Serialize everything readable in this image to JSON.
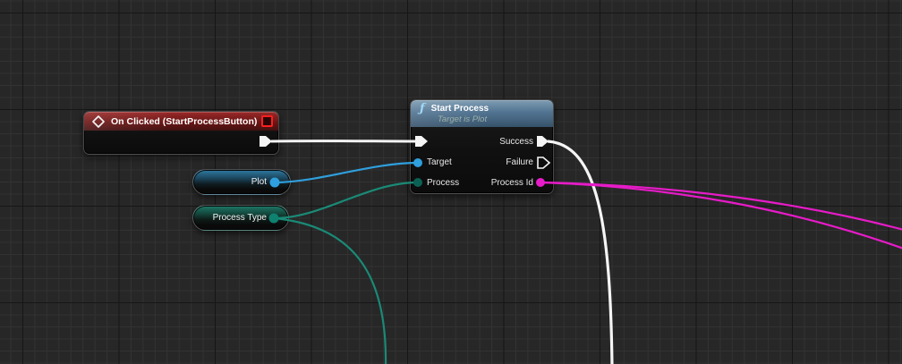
{
  "app": "blueprint-graph",
  "colors": {
    "background": "#272727",
    "grid_minor": "#323232",
    "grid_major": "#161616",
    "wire_exec": "#f5f5f5",
    "wire_object": "#2f9fdd",
    "wire_process": "#1a8a76",
    "wire_id": "#e71bc8",
    "pin_exec": "#f5f5f5",
    "pin_object": "#2f9fdd",
    "pin_process": "#0e8170",
    "pin_process_dark": "#0b6154",
    "pin_id": "#e71bc8",
    "event_header_red": "#8a2222",
    "function_header_blue": "#55809c",
    "delegate_red": "#ff1e1e"
  },
  "nodes": {
    "on_clicked": {
      "title": "On Clicked (StartProcessButton)",
      "icon": "event-diamond-icon",
      "delegate_pin": "red-square-delegate-pin",
      "exec_out": ""
    },
    "start_process": {
      "title": "Start Process",
      "subtitle": "Target is Plot",
      "function_icon": "ƒ",
      "inputs": [
        {
          "label": "Target",
          "type": "object"
        },
        {
          "label": "Process",
          "type": "process"
        }
      ],
      "outputs": [
        {
          "label": "Success",
          "type": "exec"
        },
        {
          "label": "Failure",
          "type": "exec"
        },
        {
          "label": "Process Id",
          "type": "id"
        }
      ]
    },
    "plot": {
      "label": "Plot",
      "type": "object"
    },
    "process_type": {
      "label": "Process Type",
      "type": "process"
    }
  }
}
